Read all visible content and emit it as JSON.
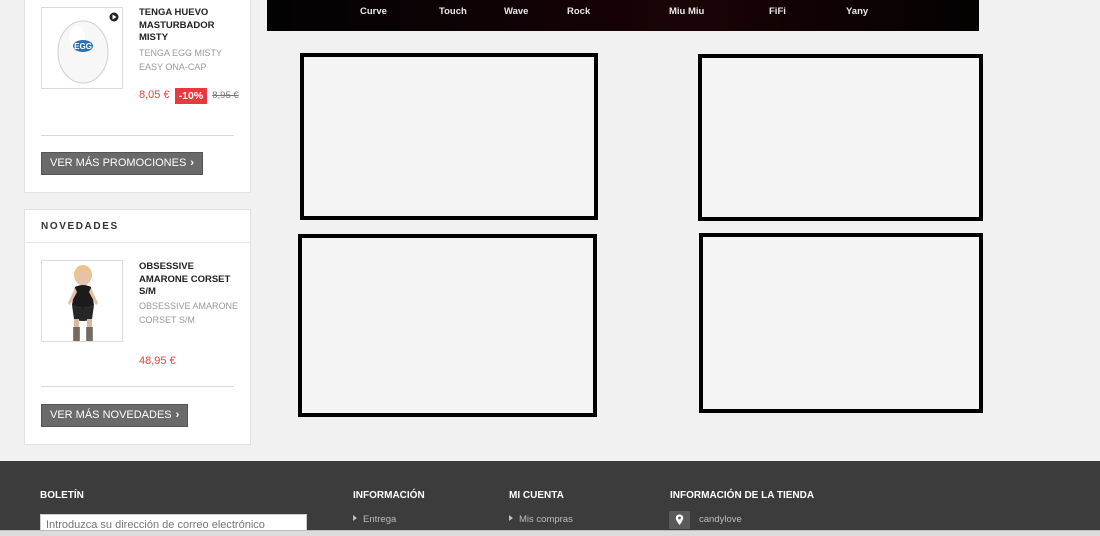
{
  "sidebar": {
    "promo": {
      "product": {
        "name": "TENGA HUEVO MASTURBADOR MISTY",
        "desc": "TENGA EGG MISTY EASY ONA-CAP",
        "price": "8,05 €",
        "discount": "-10%",
        "old_price": "8,95 €"
      },
      "more_label": "VER MÁS PROMOCIONES"
    },
    "new": {
      "title": "NOVEDADES",
      "product": {
        "name": "OBSESSIVE AMARONE CORSET S/M",
        "desc": "OBSESSIVE AMARONE CORSET S/M",
        "price": "48,95 €"
      },
      "more_label": "VER MÁS NOVEDADES"
    }
  },
  "topnav": {
    "items": [
      "Curve",
      "Touch",
      "Wave",
      "Rock",
      "Miu Miu",
      "FiFi",
      "Yany"
    ]
  },
  "footer": {
    "newsletter": {
      "title": "BOLETÍN",
      "placeholder": "Introduzca su dirección de correo electrónico"
    },
    "info": {
      "title": "INFORMACIÓN",
      "link": "Entrega"
    },
    "account": {
      "title": "MI CUENTA",
      "link": "Mis compras"
    },
    "store": {
      "title": "INFORMACIÓN DE LA TIENDA",
      "name": "candylove"
    }
  },
  "colors": {
    "accent_red": "#e8393f",
    "button_gray": "#6a6a6a",
    "footer_bg": "#3c3c3c",
    "page_bg": "#f1f1f1"
  },
  "icons": [
    "play-icon",
    "chevron-right-icon",
    "map-pin-icon",
    "arrow-right-icon"
  ]
}
